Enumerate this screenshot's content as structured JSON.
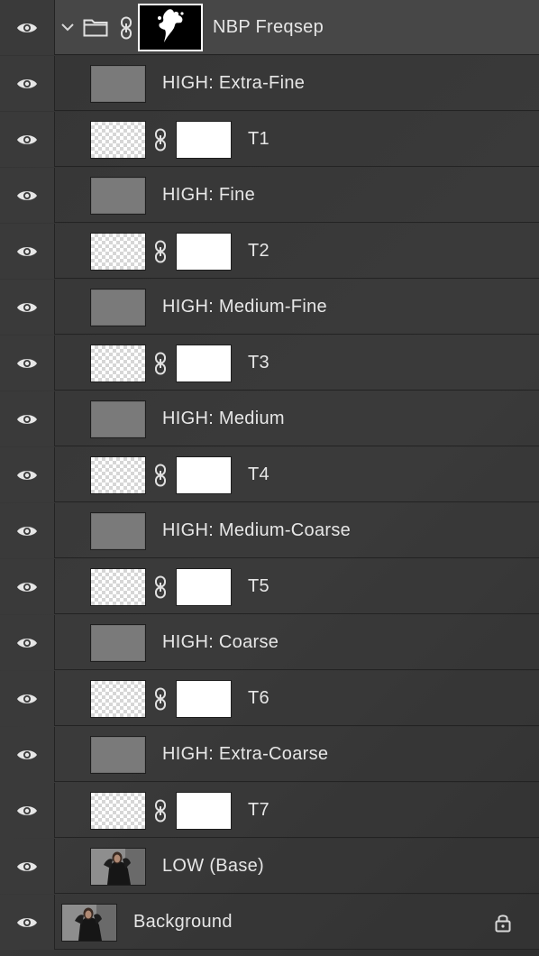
{
  "panel": "Layers",
  "colors": {
    "row_bg": "#3a3a3a",
    "group_row_bg": "#474747",
    "text": "#e6e6e6",
    "divider": "#232323",
    "gray_fill": "#7a7a7a"
  },
  "group": {
    "name": "NBP Freqsep",
    "expanded": true,
    "icons": [
      "eye-icon",
      "chevron-down-icon",
      "folder-icon",
      "link-icon",
      "mask-thumbnail"
    ]
  },
  "layers": [
    {
      "name": "HIGH: Extra-Fine",
      "kind": "gray-fill"
    },
    {
      "name": "T1",
      "kind": "transparent-with-mask"
    },
    {
      "name": "HIGH: Fine",
      "kind": "gray-fill"
    },
    {
      "name": "T2",
      "kind": "transparent-with-mask"
    },
    {
      "name": "HIGH: Medium-Fine",
      "kind": "gray-fill"
    },
    {
      "name": "T3",
      "kind": "transparent-with-mask"
    },
    {
      "name": "HIGH: Medium",
      "kind": "gray-fill"
    },
    {
      "name": "T4",
      "kind": "transparent-with-mask"
    },
    {
      "name": "HIGH: Medium-Coarse",
      "kind": "gray-fill"
    },
    {
      "name": "T5",
      "kind": "transparent-with-mask"
    },
    {
      "name": "HIGH: Coarse",
      "kind": "gray-fill"
    },
    {
      "name": "T6",
      "kind": "transparent-with-mask"
    },
    {
      "name": "HIGH: Extra-Coarse",
      "kind": "gray-fill"
    },
    {
      "name": "T7",
      "kind": "transparent-with-mask"
    },
    {
      "name": "LOW (Base)",
      "kind": "photo"
    }
  ],
  "background": {
    "name": "Background",
    "locked": true,
    "icons": [
      "eye-icon",
      "photo-thumbnail",
      "lock-icon"
    ]
  }
}
